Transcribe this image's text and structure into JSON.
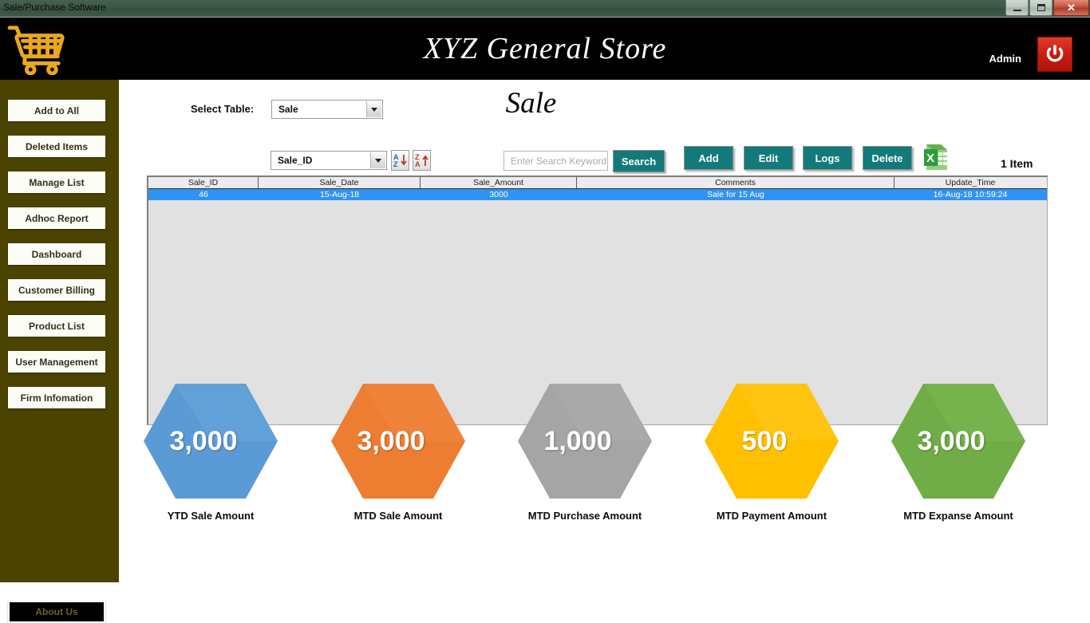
{
  "window": {
    "title": "Sale/Purchase Software",
    "minimize_label": "minimize",
    "maximize_label": "maximize",
    "close_label": "✕"
  },
  "header": {
    "app_title": "XYZ General Store",
    "user_label": "Admin",
    "cart_icon": "shopping-cart-icon",
    "power_icon": "power-icon",
    "background_color": "#000000",
    "accent_color": "#eaa81e"
  },
  "sidebar": {
    "background_color": "#4a4400",
    "items": [
      {
        "label": "Add to All"
      },
      {
        "label": "Deleted Items"
      },
      {
        "label": "Manage List"
      },
      {
        "label": "Adhoc Report"
      },
      {
        "label": "Dashboard"
      },
      {
        "label": "Customer Billing"
      },
      {
        "label": "Product List"
      },
      {
        "label": "User Management"
      },
      {
        "label": "Firm Infomation"
      }
    ],
    "about": {
      "label": "About Us"
    }
  },
  "main": {
    "page_title": "Sale",
    "select_table_label": "Select Table:",
    "select_table_value": "Sale",
    "sort_field_value": "Sale_ID",
    "sort_asc_icon": "sort-a-z-icon",
    "sort_desc_icon": "sort-z-a-icon",
    "search_placeholder": "Enter Search Keyword",
    "search_value": "",
    "buttons": {
      "search": "Search",
      "add": "Add",
      "edit": "Edit",
      "logs": "Logs",
      "delete": "Delete"
    },
    "export_icon": "excel-export-icon",
    "item_count": "1 Item",
    "accent_color": "#127a7a"
  },
  "grid": {
    "columns": [
      "Sale_ID",
      "Sale_Date",
      "Sale_Amount",
      "Comments",
      "Update_Time"
    ],
    "rows": [
      {
        "sale_id": "46",
        "sale_date": "15-Aug-18",
        "sale_amount": "3000",
        "comments": "Sale for 15 Aug",
        "update_time": "16-Aug-18 10:59:24",
        "selected": true
      }
    ],
    "selected_row_color": "#2f93f3",
    "body_color": "#e1e1e1"
  },
  "chart_data": {
    "type": "bar",
    "title": "",
    "categories": [
      "YTD Sale Amount",
      "MTD Sale Amount",
      "MTD Purchase Amount",
      "MTD Payment Amount",
      "MTD Expanse Amount"
    ],
    "values": [
      3000,
      3000,
      1000,
      500,
      3000
    ],
    "value_labels": [
      "3,000",
      "3,000",
      "1,000",
      "500",
      "3,000"
    ],
    "colors": [
      "#5b9bd5",
      "#ed7d31",
      "#a5a5a5",
      "#ffc000",
      "#70ad47"
    ],
    "xlabel": "",
    "ylabel": "",
    "legend": "none"
  },
  "kpis": [
    {
      "value": "3,000",
      "label": "YTD Sale Amount",
      "color": "#5b9bd5",
      "color_dark": "#4a8bc4"
    },
    {
      "value": "3,000",
      "label": "MTD Sale Amount",
      "color": "#ed7d31",
      "color_dark": "#df6c20"
    },
    {
      "value": "1,000",
      "label": "MTD Purchase Amount",
      "color": "#a5a5a5",
      "color_dark": "#959595"
    },
    {
      "value": "500",
      "label": "MTD Payment Amount",
      "color": "#ffc000",
      "color_dark": "#efb000"
    },
    {
      "value": "3,000",
      "label": "MTD Expanse Amount",
      "color": "#70ad47",
      "color_dark": "#619c38"
    }
  ]
}
